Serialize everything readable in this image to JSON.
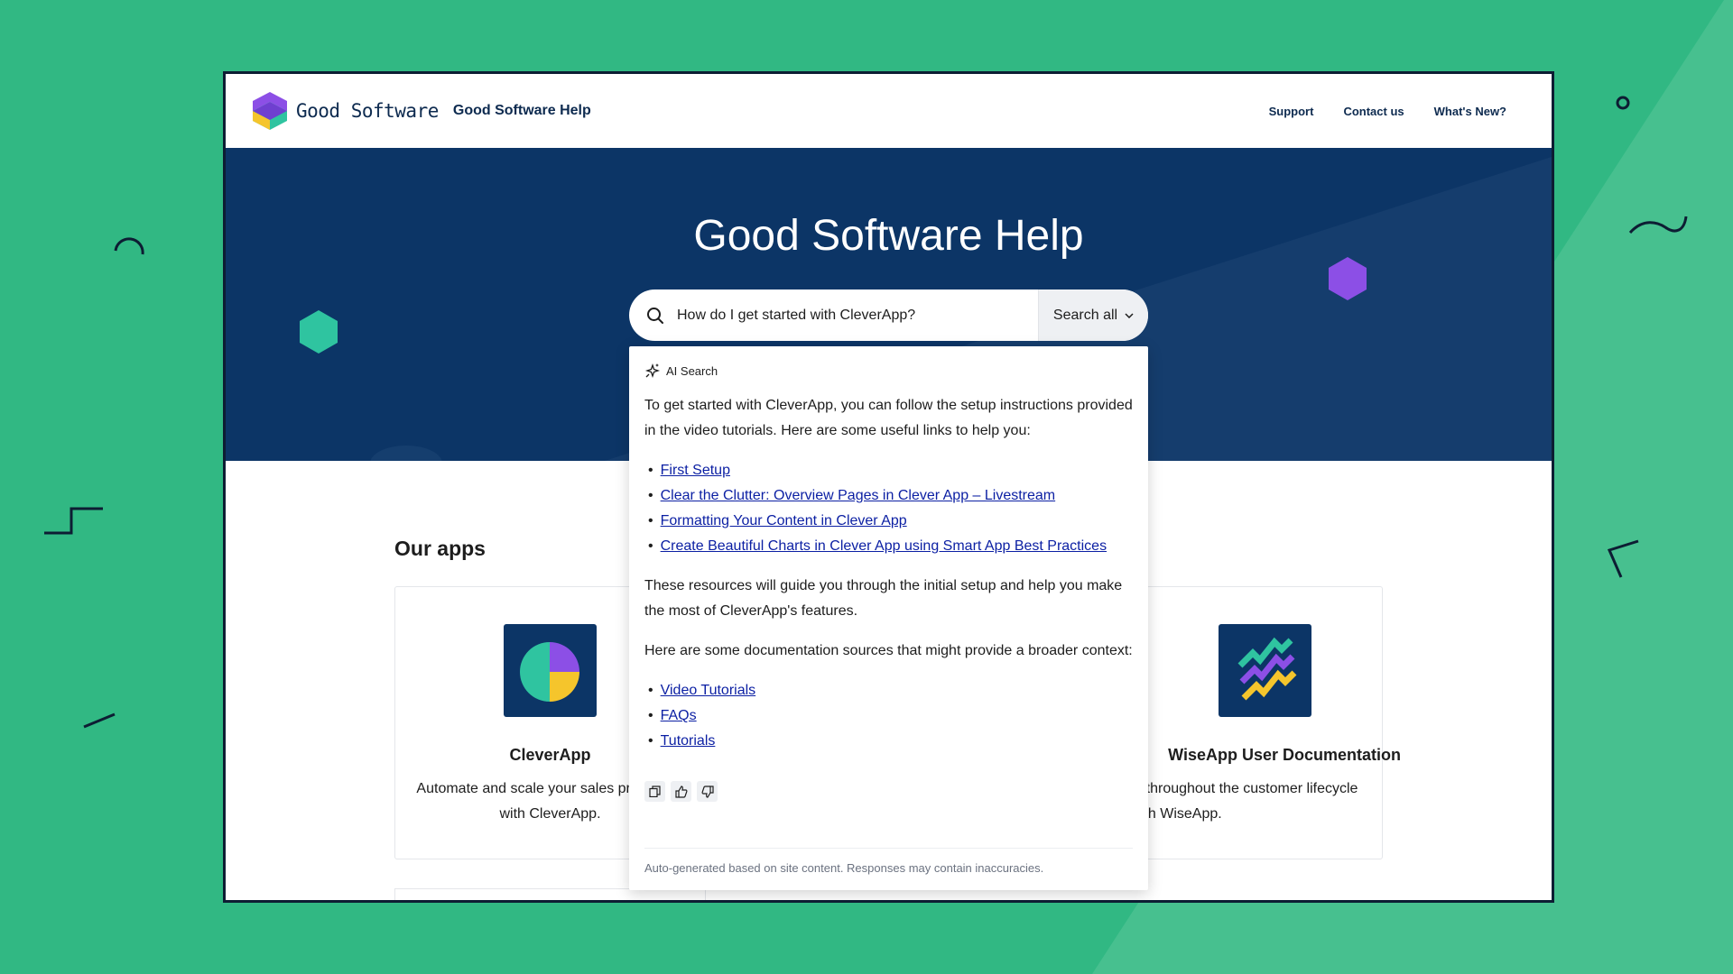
{
  "header": {
    "brand": "Good Software",
    "site_title": "Good Software Help",
    "nav": [
      "Support",
      "Contact us",
      "What's New?"
    ]
  },
  "hero": {
    "title": "Good Software Help",
    "search": {
      "value": "How do I get started with CleverApp?",
      "scope_label": "Search all"
    }
  },
  "main": {
    "section_title": "Our apps",
    "apps": [
      {
        "name": "CleverApp",
        "description": "Automate and scale your sales processes with CleverApp.",
        "icon": "cleverapp-pie-icon"
      },
      {
        "name": "WiseApp User Documentation",
        "description": "Manage customer data throughout the customer lifecycle with WiseApp.",
        "icon": "wiseapp-zigzag-icon"
      }
    ]
  },
  "ai_search": {
    "label": "AI Search",
    "intro": "To get started with CleverApp, you can follow the setup instructions provided in the video tutorials. Here are some useful links to help you:",
    "links": [
      "First Setup",
      "Clear the Clutter: Overview Pages in Clever App – Livestream",
      "Formatting Your Content in Clever App",
      "Create Beautiful Charts in Clever App using Smart App Best Practices"
    ],
    "middle": "These resources will guide you through the initial setup and help you make the most of CleverApp's features.",
    "sources_intro": "Here are some documentation sources that might provide a broader context:",
    "sources": [
      "Video Tutorials",
      "FAQs",
      "Tutorials"
    ],
    "footer": "Auto-generated based on site content. Responses may contain inaccuracies."
  },
  "colors": {
    "background": "#31b883",
    "hero": "#0c3566",
    "link": "#0b1fa3",
    "accent_purple": "#8c4fe6",
    "accent_teal": "#2fc4a0",
    "accent_yellow": "#f5c52c"
  }
}
